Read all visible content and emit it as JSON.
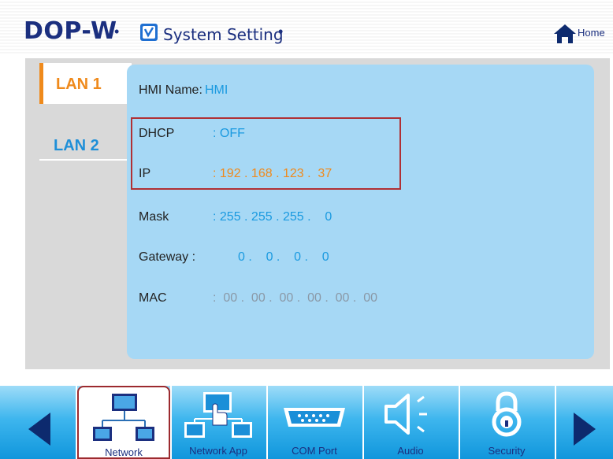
{
  "header": {
    "brand": "DOP-W",
    "dot": "•",
    "title": "System Setting",
    "home_label": "Home"
  },
  "tabs": [
    {
      "label": "LAN 1",
      "state": "active"
    },
    {
      "label": "LAN 2",
      "state": "inactive"
    }
  ],
  "settings": {
    "hmi_name_label": "HMI Name:",
    "hmi_name_value": "HMI",
    "dhcp_label": "DHCP",
    "dhcp_value": ": OFF",
    "ip_label": "IP",
    "ip_value": ": 192 . 168 . 123 .  37",
    "mask_label": "Mask",
    "mask_value": ": 255 . 255 . 255 .    0",
    "gateway_label": "Gateway :",
    "gateway_value": "0 .    0 .    0 .    0",
    "mac_label": "MAC",
    "mac_value": ":  00 .  00 .  00 .  00 .  00 .  00"
  },
  "bottom_nav": {
    "items": [
      {
        "label": "Network",
        "icon": "network-icon",
        "selected": true
      },
      {
        "label": "Network  App",
        "icon": "network-app-icon",
        "selected": false
      },
      {
        "label": "COM Port",
        "icon": "com-port-icon",
        "selected": false
      },
      {
        "label": "Audio",
        "icon": "audio-icon",
        "selected": false
      },
      {
        "label": "Security",
        "icon": "security-icon",
        "selected": false
      }
    ],
    "prev_icon": "left-arrow-icon",
    "next_icon": "right-arrow-icon"
  },
  "colors": {
    "brand": "#1b2f7f",
    "accent_orange": "#f08a1c",
    "value_blue": "#1a9ae0",
    "panel": "#a6d8f5",
    "highlight_border": "#b03034"
  }
}
